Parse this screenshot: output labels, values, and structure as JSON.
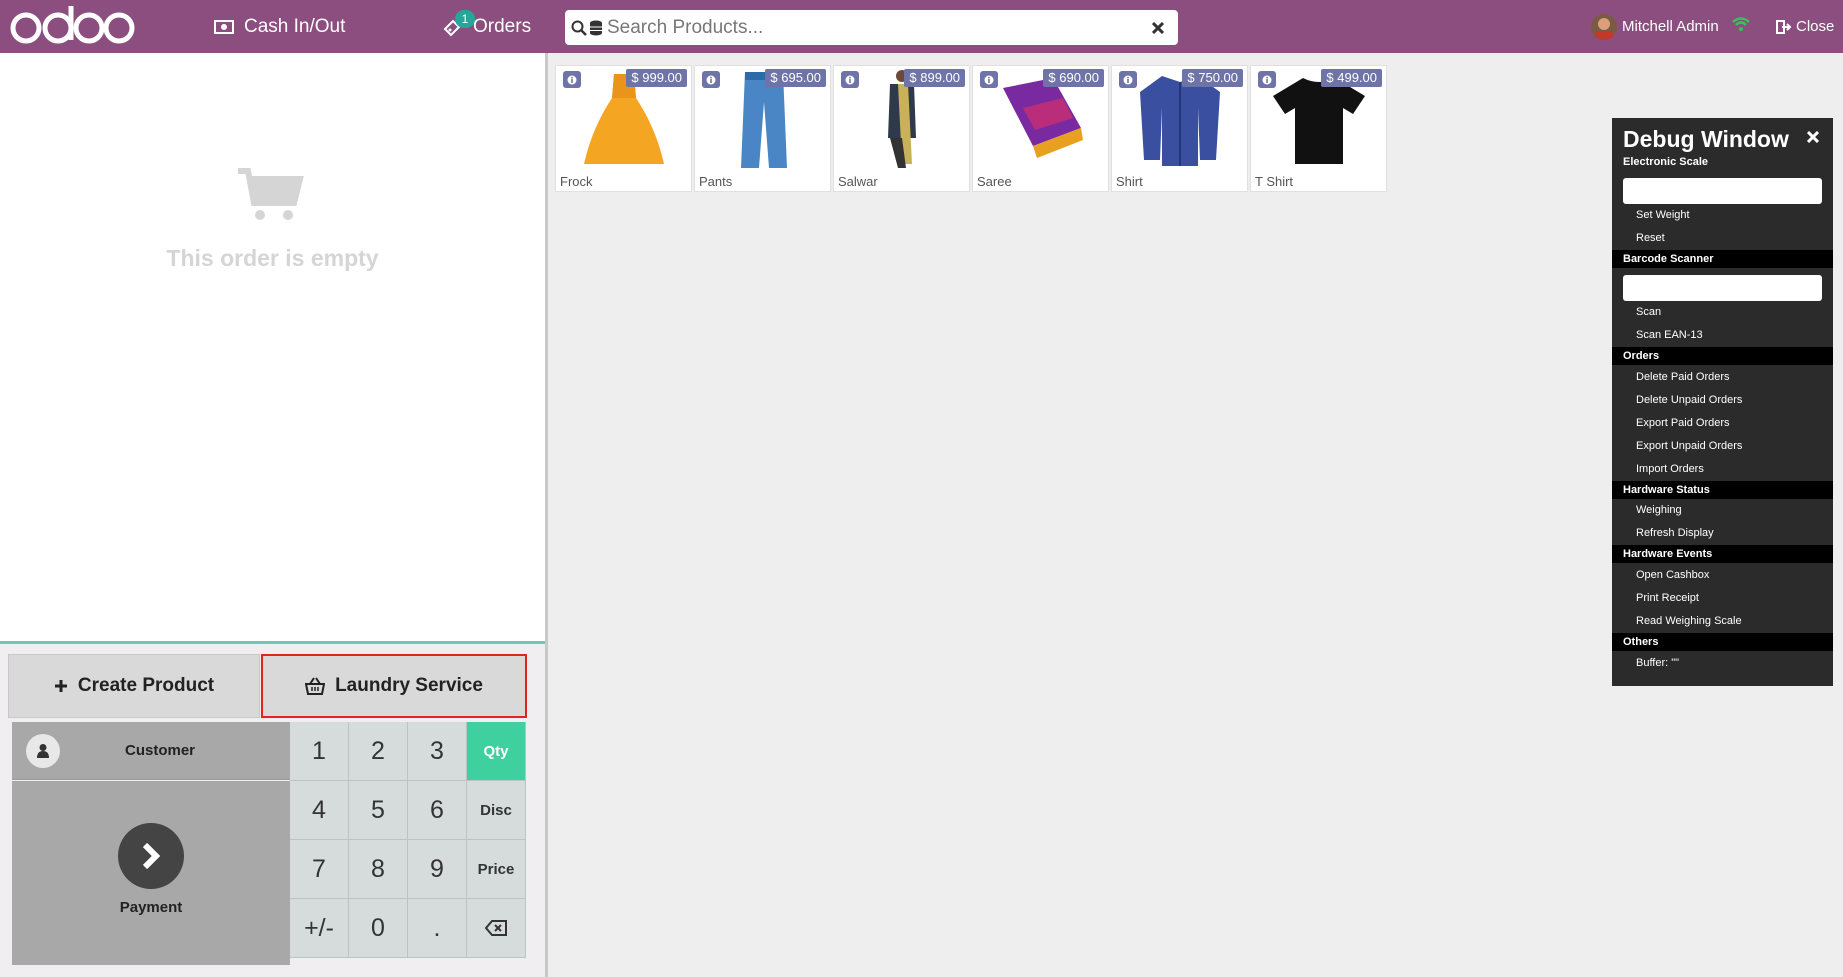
{
  "header": {
    "logo": "odoo",
    "cash_label": "Cash In/Out",
    "orders_label": "Orders",
    "orders_badge": "1",
    "search_placeholder": "Search Products...",
    "user_name": "Mitchell Admin",
    "close_label": "Close",
    "bar_color": "#8b4e7e"
  },
  "order": {
    "empty_text": "This order is empty"
  },
  "actions": {
    "create_product": "Create Product",
    "laundry_service": "Laundry Service"
  },
  "numpad": {
    "customer": "Customer",
    "payment": "Payment",
    "keys": [
      "1",
      "2",
      "3",
      "Qty",
      "4",
      "5",
      "6",
      "Disc",
      "7",
      "8",
      "9",
      "Price",
      "+/-",
      "0",
      "."
    ],
    "active_mode": "Qty",
    "active_color": "#3fd0a0"
  },
  "products": [
    {
      "name": "Frock",
      "price": "$ 999.00",
      "icon": "frock-image"
    },
    {
      "name": "Pants",
      "price": "$ 695.00",
      "icon": "pants-image"
    },
    {
      "name": "Salwar",
      "price": "$ 899.00",
      "icon": "salwar-image"
    },
    {
      "name": "Saree",
      "price": "$ 690.00",
      "icon": "saree-image"
    },
    {
      "name": "Shirt",
      "price": "$ 750.00",
      "icon": "shirt-image"
    },
    {
      "name": "T Shirt",
      "price": "$ 499.00",
      "icon": "tshirt-image"
    }
  ],
  "debug": {
    "title": "Debug Window",
    "electronic_scale": "Electronic Scale",
    "set_weight": "Set Weight",
    "reset": "Reset",
    "barcode_scanner": "Barcode Scanner",
    "scan": "Scan",
    "scan_ean": "Scan EAN-13",
    "orders": "Orders",
    "delete_paid": "Delete Paid Orders",
    "delete_unpaid": "Delete Unpaid Orders",
    "export_paid": "Export Paid Orders",
    "export_unpaid": "Export Unpaid Orders",
    "import_orders": "Import Orders",
    "hardware_status": "Hardware Status",
    "weighing": "Weighing",
    "refresh_display": "Refresh Display",
    "hardware_events": "Hardware Events",
    "open_cashbox": "Open Cashbox",
    "print_receipt": "Print Receipt",
    "read_scale": "Read Weighing Scale",
    "others": "Others",
    "buffer": "Buffer: \"\""
  }
}
